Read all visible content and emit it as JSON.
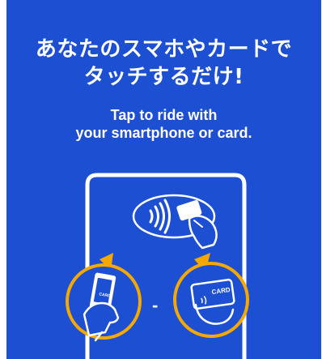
{
  "poster": {
    "title_line1": "あなたのスマホやカードで",
    "title_line2": "タッチするだけ!",
    "subtitle_line1": "Tap to ride with",
    "subtitle_line2": "your smartphone or card.",
    "card_label": "CARD",
    "phone_card_label": "CARD",
    "separator": "-"
  },
  "colors": {
    "background": "#1c4fd2",
    "accent": "#f5a800",
    "text": "#ffffff"
  },
  "icons": [
    "contactless-icon",
    "smartphone-icon",
    "card-icon",
    "hand-icon"
  ]
}
